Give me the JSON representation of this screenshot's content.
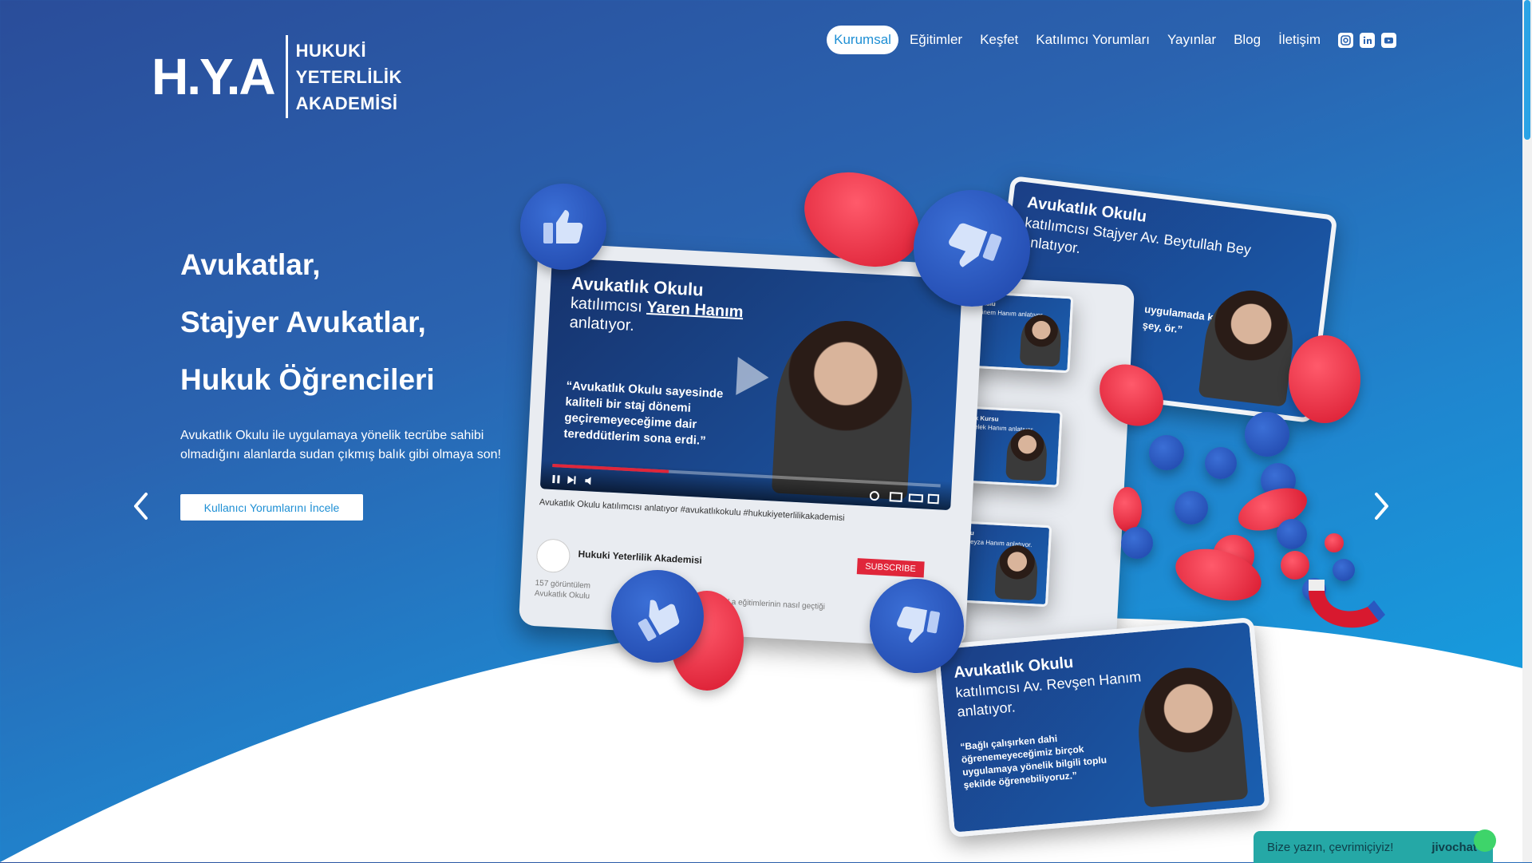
{
  "logo": {
    "mark": "H.Y.A",
    "lines": [
      "HUKUKİ",
      "YETERLİLİK",
      "AKADEMİSİ"
    ]
  },
  "nav": {
    "items": [
      "Kurumsal",
      "Eğitimler",
      "Keşfet",
      "Katılımcı Yorumları",
      "Yayınlar",
      "Blog",
      "İletişim"
    ],
    "active": "Kurumsal",
    "social": [
      "instagram-icon",
      "linkedin-icon",
      "youtube-icon"
    ]
  },
  "hero": {
    "lines": [
      "Avukatlar,",
      "Stajyer Avukatlar,",
      "Hukuk Öğrencileri"
    ],
    "description": "Avukatlık Okulu ile uygulamaya yönelik tecrübe sahibi olmadığını alanlarda sudan çıkmış balık gibi olmaya son!",
    "button": "Kullanıcı Yorumlarını İncele"
  },
  "collage": {
    "player": {
      "title": "Avukatlık Okulu",
      "subtitle_prefix": "katılımcısı",
      "subtitle_name": "Yaren Hanım",
      "subtitle_suffix": "anlatıyor.",
      "quote": "“Avukatlık Okulu sayesinde kaliteli bir staj dönemi geçiremeyeceğime dair tereddütlerim sona erdi.”",
      "caption": "Avukatlık Okulu katılımcısı anlatıyor #avukatlıkokulu #hukukiyeterlilikakademisi",
      "channel": "Hukuki Yeterlilik Akademisi",
      "subscribe": "SUBSCRIBE",
      "views": "157 görüntülem",
      "meta": "Avukatlık Okulu",
      "desc_tail": "ren Yıldır' a eğitimlerinin nasıl geçtiği"
    },
    "card_beytullah": {
      "title": "Avukatlık Okulu",
      "subtitle": "katılımcısı Stajyer Av. Beytullah Bey",
      "suffix": "anlatıyor.",
      "fragment": "uygulamada k şey, ör.”"
    },
    "card_revsen": {
      "title": "Avukatlık Okulu",
      "subtitle": "katılımcısı Av. Revşen Hanım",
      "suffix": "anlatıyor.",
      "quote": "“Bağlı çalışırken dahi öğrenemeyeceğimiz birçok uygulamaya yönelik bilgili toplu şekilde öğrenebiliyoruz.”"
    },
    "mini_cards": [
      {
        "title": "Avukatlık Okulu",
        "sub": "katılımcısı Sinem Hanım anlatıyor."
      },
      {
        "title": "İdari Hakimlik Kursu",
        "sub": "öğrencimiz Melek Hanım anlatıyor."
      },
      {
        "title": "Avukatlık Okulu",
        "sub": "katılımcısı Av. Beyza Hanım anlatıyor."
      }
    ]
  },
  "chat": {
    "text": "Bize yazın, çevrimiçiyiz!",
    "brand": "jivochat"
  },
  "colors": {
    "accent": "#1e8fd4",
    "chat_bg": "#25a8a6",
    "heart": "#e0263a",
    "like": "#2a58c0"
  }
}
